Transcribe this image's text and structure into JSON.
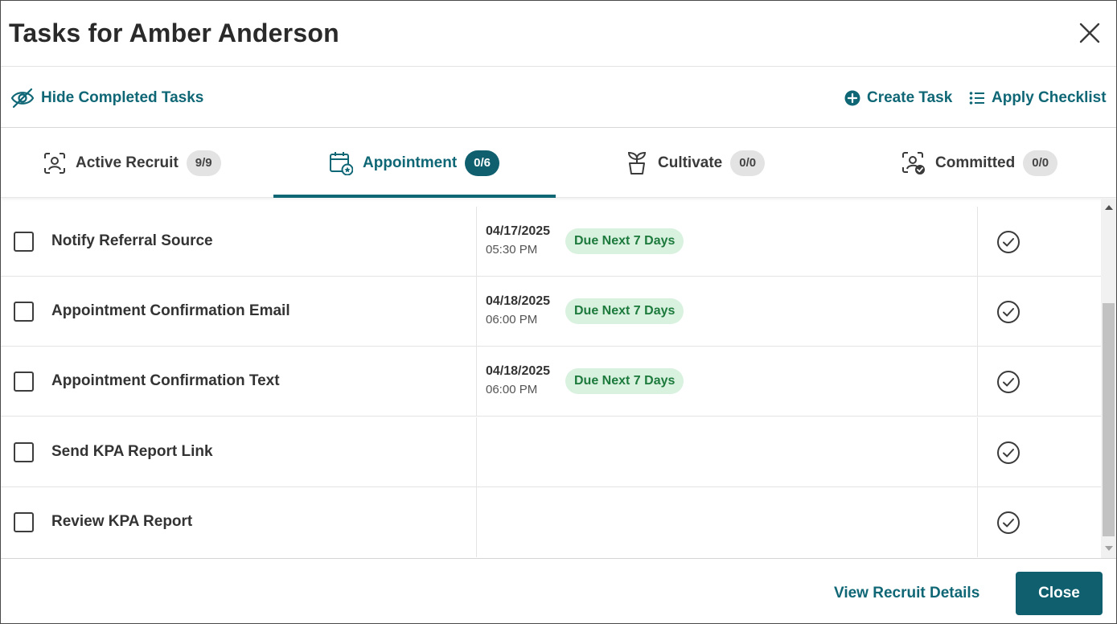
{
  "header": {
    "title": "Tasks for Amber Anderson"
  },
  "toolbar": {
    "hide_completed": "Hide Completed Tasks",
    "create_task": "Create Task",
    "apply_checklist": "Apply Checklist"
  },
  "tabs": [
    {
      "label": "Active Recruit",
      "count": "9/9",
      "icon": "person-scan-icon"
    },
    {
      "label": "Appointment",
      "count": "0/6",
      "icon": "calendar-star-icon",
      "active": true
    },
    {
      "label": "Cultivate",
      "count": "0/0",
      "icon": "plant-pot-icon"
    },
    {
      "label": "Committed",
      "count": "0/0",
      "icon": "person-check-icon"
    }
  ],
  "tasks": [
    {
      "name": "Notify Referral Source",
      "date": "04/17/2025",
      "time": "05:30 PM",
      "badge": "Due Next 7 Days"
    },
    {
      "name": "Appointment Confirmation Email",
      "date": "04/18/2025",
      "time": "06:00 PM",
      "badge": "Due Next 7 Days"
    },
    {
      "name": "Appointment Confirmation Text",
      "date": "04/18/2025",
      "time": "06:00 PM",
      "badge": "Due Next 7 Days"
    },
    {
      "name": "Send KPA Report Link"
    },
    {
      "name": "Review KPA Report"
    }
  ],
  "footer": {
    "view_details": "View Recruit Details",
    "close": "Close"
  },
  "colors": {
    "accent": "#0f6776",
    "badge_active": "#0f5f6e",
    "due_badge_bg": "#d9f1df",
    "due_badge_text": "#1c7a3c"
  }
}
